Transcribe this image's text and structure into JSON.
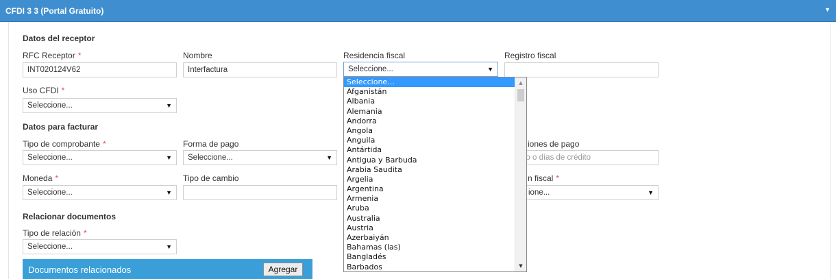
{
  "header": {
    "title": "CFDI 3 3 (Portal Gratuito)",
    "toggle_icon": "caret-down-icon"
  },
  "receptor": {
    "section_title": "Datos del receptor",
    "rfc_label": "RFC Receptor",
    "rfc_value": "INT020124V62",
    "nombre_label": "Nombre",
    "nombre_value": "Interfactura",
    "residencia_label": "Residencia fiscal",
    "residencia_value": "Seleccione...",
    "registro_label": "Registro fiscal",
    "registro_value": "",
    "uso_label": "Uso CFDI",
    "uso_value": "Seleccione..."
  },
  "facturar": {
    "section_title": "Datos para facturar",
    "tipo_comprobante_label": "Tipo de comprobante",
    "tipo_comprobante_value": "Seleccione...",
    "forma_pago_label": "Forma de pago",
    "forma_pago_value": "Seleccione...",
    "condiciones_label_partial": "iones de pago",
    "condiciones_placeholder_partial": "do o días de crédito",
    "moneda_label": "Moneda",
    "moneda_value": "Seleccione...",
    "tipo_cambio_label": "Tipo de cambio",
    "tipo_cambio_value": "",
    "regimen_label_partial": "n fiscal",
    "regimen_value_partial": "ione..."
  },
  "relacionar": {
    "section_title": "Relacionar documentos",
    "tipo_relacion_label": "Tipo de relación",
    "tipo_relacion_value": "Seleccione...",
    "docs_bar_title": "Documentos relacionados",
    "add_button": "Agregar"
  },
  "required_marker": "*",
  "dropdown_arrow": "▼",
  "residencia_options": [
    "Seleccione...",
    "Afganistán",
    "Albania",
    "Alemania",
    "Andorra",
    "Angola",
    "Anguila",
    "Antártida",
    "Antigua y Barbuda",
    "Arabia Saudita",
    "Argelia",
    "Argentina",
    "Armenia",
    "Aruba",
    "Australia",
    "Austria",
    "Azerbaiyán",
    "Bahamas (las)",
    "Bangladés",
    "Barbados"
  ],
  "residencia_selected_index": 0
}
